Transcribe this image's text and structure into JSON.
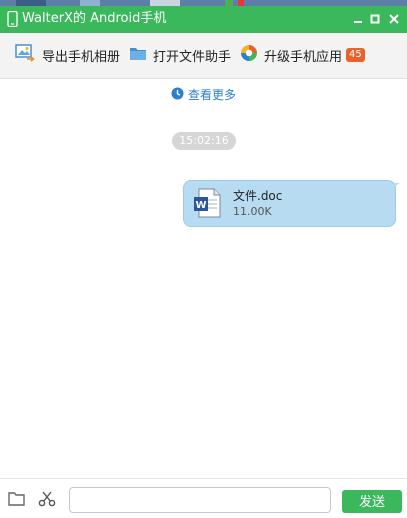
{
  "window": {
    "title": "WalterX的 Android手机",
    "controls": [
      "minimize-icon",
      "maximize-icon",
      "close-icon"
    ]
  },
  "toolbar": {
    "export_album": "导出手机相册",
    "open_file_assistant": "打开文件助手",
    "upgrade_apps": "升级手机应用",
    "upgrade_badge": "45"
  },
  "chat": {
    "view_more": "查看更多",
    "timestamp": "15:02:16",
    "message": {
      "file_name": "文件.doc",
      "file_size": "11.00K",
      "icon": "word-doc-icon"
    }
  },
  "footer": {
    "input_value": "",
    "send_label": "发送"
  },
  "colors": {
    "titlebar": "#3cb85c",
    "send_button": "#3cb85c",
    "link": "#2d7ecb",
    "bubble": "#b7dcf1",
    "badge": "#e8632b"
  }
}
